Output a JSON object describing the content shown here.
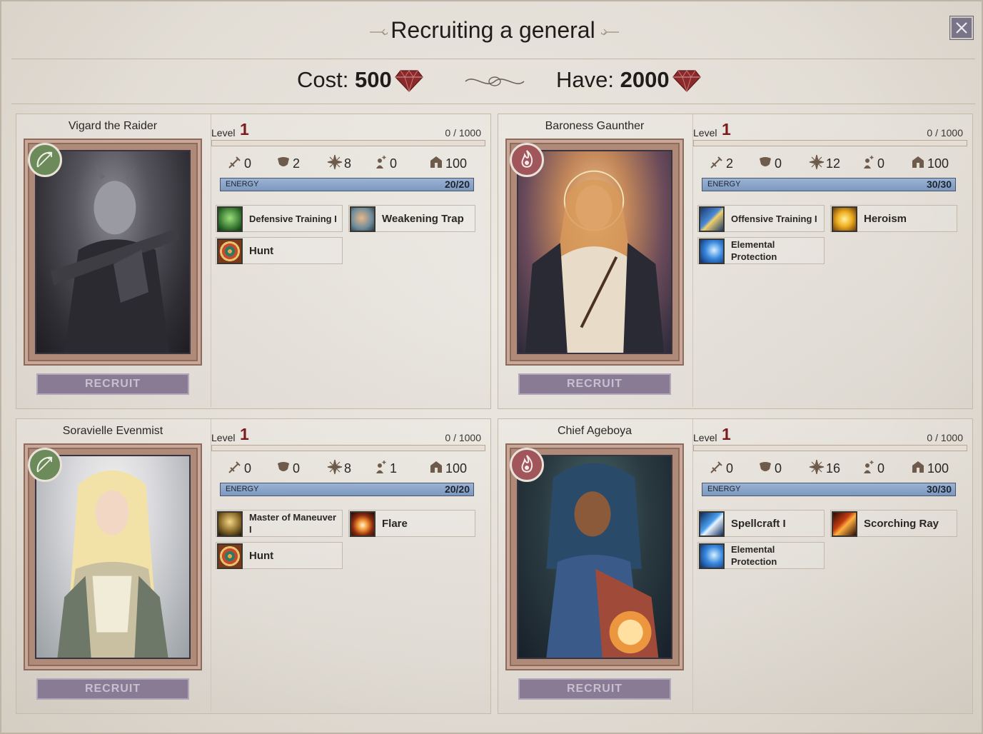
{
  "header": {
    "title": "Recruiting a general",
    "close_icon": "close-icon",
    "cost_label": "Cost:",
    "cost_value": "500",
    "have_label": "Have:",
    "have_value": "2000",
    "currency_icon": "gem-icon"
  },
  "generals": [
    {
      "name": "Vigard the Raider",
      "class_icon": "bow-icon",
      "level_label": "Level",
      "level": "1",
      "xp": "0 / 1000",
      "stats": [
        "0",
        "2",
        "8",
        "0",
        "100"
      ],
      "energy_label": "ENERGY",
      "energy": "20/20",
      "energy_fraction": 1.0,
      "skills": [
        {
          "label": "Defensive Training I",
          "icon": "armor-icon"
        },
        {
          "label": "Weakening Trap",
          "icon": "trap-icon"
        },
        {
          "label": "Hunt",
          "icon": "target-icon"
        }
      ],
      "recruit_label": "RECRUIT"
    },
    {
      "name": "Baroness Gaunther",
      "class_icon": "fire-icon",
      "level_label": "Level",
      "level": "1",
      "xp": "0 / 1000",
      "stats": [
        "2",
        "0",
        "12",
        "0",
        "100"
      ],
      "energy_label": "ENERGY",
      "energy": "30/30",
      "energy_fraction": 1.0,
      "skills": [
        {
          "label": "Offensive Training I",
          "icon": "sword-icon"
        },
        {
          "label": "Heroism",
          "icon": "fist-icon"
        },
        {
          "label": "Elemental Protection",
          "icon": "shield-web-icon"
        }
      ],
      "recruit_label": "RECRUIT"
    },
    {
      "name": "Soravielle Evenmist",
      "class_icon": "bow-icon",
      "level_label": "Level",
      "level": "1",
      "xp": "0 / 1000",
      "stats": [
        "0",
        "0",
        "8",
        "1",
        "100"
      ],
      "energy_label": "ENERGY",
      "energy": "20/20",
      "energy_fraction": 1.0,
      "skills": [
        {
          "label": "Master of Maneuver I",
          "icon": "runner-icon"
        },
        {
          "label": "Flare",
          "icon": "flare-icon"
        },
        {
          "label": "Hunt",
          "icon": "target-icon"
        }
      ],
      "recruit_label": "RECRUIT"
    },
    {
      "name": "Chief Ageboya",
      "class_icon": "fire-icon",
      "level_label": "Level",
      "level": "1",
      "xp": "0 / 1000",
      "stats": [
        "0",
        "0",
        "16",
        "0",
        "100"
      ],
      "energy_label": "ENERGY",
      "energy": "30/30",
      "energy_fraction": 1.0,
      "skills": [
        {
          "label": "Spellcraft I",
          "icon": "spell-bolt-icon"
        },
        {
          "label": "Scorching Ray",
          "icon": "fire-ray-icon"
        },
        {
          "label": "Elemental Protection",
          "icon": "shield-web-icon"
        }
      ],
      "recruit_label": "RECRUIT"
    }
  ],
  "stat_icons": [
    "attack-icon",
    "defense-icon",
    "spell-power-icon",
    "initiative-icon",
    "leadership-icon"
  ],
  "colors": {
    "level_number": "#7a1c1c",
    "energy_fill": "#8aa6cc",
    "recruit_button": "#8a7b94",
    "gem": "#8b2a2a",
    "class_badge_green": "#6c8a5a",
    "class_badge_red": "#a0565a"
  }
}
